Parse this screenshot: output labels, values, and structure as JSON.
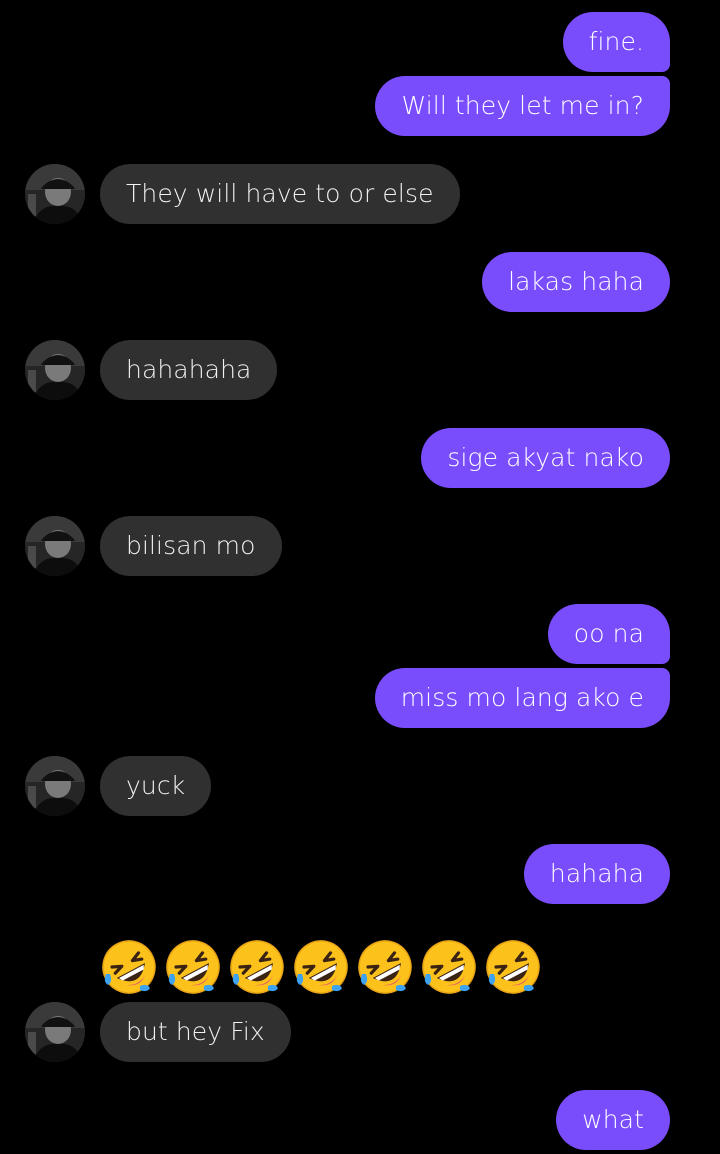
{
  "colors": {
    "background": "#000000",
    "sent_bubble": "#7a4dfc",
    "received_bubble": "#303030",
    "text": "#ffffff"
  },
  "messages": [
    {
      "from": "me",
      "text": "fine."
    },
    {
      "from": "me",
      "text": "Will they let me in?"
    },
    {
      "from": "them",
      "text": "They will have to or else"
    },
    {
      "from": "me",
      "text": "lakas haha"
    },
    {
      "from": "them",
      "text": "hahahaha"
    },
    {
      "from": "me",
      "text": "sige akyat nako"
    },
    {
      "from": "them",
      "text": "bilisan mo"
    },
    {
      "from": "me",
      "text": "oo na"
    },
    {
      "from": "me",
      "text": "miss mo lang ako e"
    },
    {
      "from": "them",
      "text": "yuck"
    },
    {
      "from": "me",
      "text": "hahaha"
    },
    {
      "from": "them",
      "emoji": "rolling-on-floor-laughing",
      "count": 7
    },
    {
      "from": "them",
      "text": "but hey Fix"
    },
    {
      "from": "me",
      "text": "what"
    }
  ]
}
